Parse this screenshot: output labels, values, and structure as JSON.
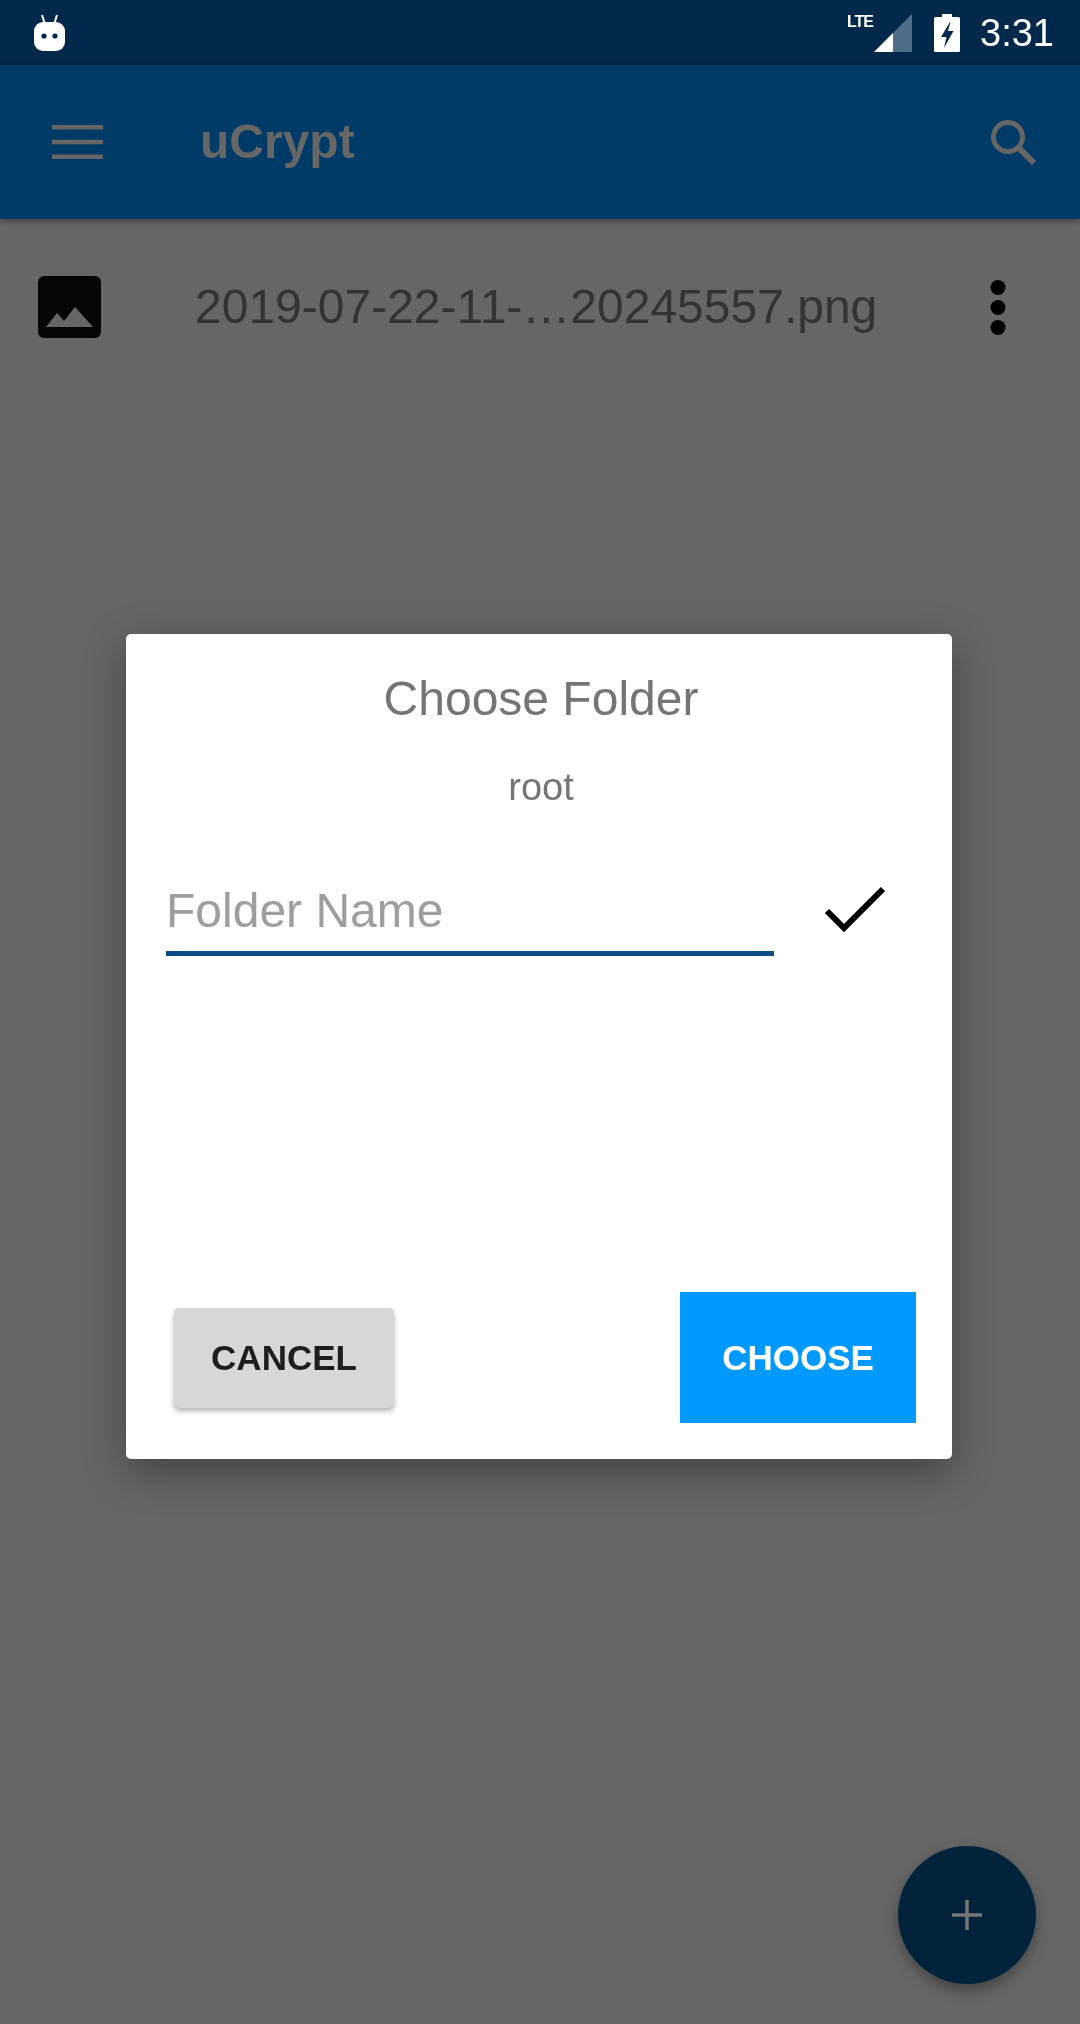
{
  "status_bar": {
    "network_type": "LTE",
    "time": "3:31"
  },
  "app_bar": {
    "title": "uCrypt"
  },
  "files": [
    {
      "name": "2019-07-22-11-…20245557.png"
    }
  ],
  "dialog": {
    "title": "Choose Folder",
    "path": "root",
    "folder_name_field": {
      "placeholder": "Folder Name"
    },
    "buttons": [
      {
        "label": "CANCEL",
        "kind": "secondary"
      },
      {
        "label": "CHOOSE",
        "kind": "primary"
      }
    ]
  }
}
